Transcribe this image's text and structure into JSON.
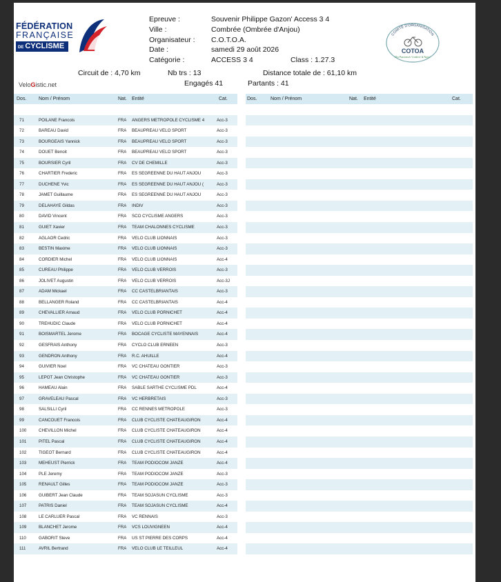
{
  "logo": {
    "line1": "FÉDÉRATION",
    "line2": "FRANÇAISE",
    "line3_prefix": "DE",
    "line3": "CYCLISME"
  },
  "event": [
    {
      "label": "Epreuve :",
      "value": "Souvenir Philippe Gazon' Access 3 4"
    },
    {
      "label": "Ville :",
      "value": "Combrée (Ombrée d'Anjou)"
    },
    {
      "label": "Organisateur :",
      "value": "C.O.T.O.A."
    },
    {
      "label": "Date :",
      "value": "samedi 29 août 2026"
    },
    {
      "label": "Catégorie :",
      "value": "ACCESS 3 4"
    }
  ],
  "class_text": "Class :   1.27.3",
  "stats": {
    "circuit": "Circuit de : 4,70  km",
    "nb_trs": "Nb trs :  13",
    "distance": "Distance totale de : 61,10  km",
    "engages": "Engagés  41",
    "partants": "Partants :  41"
  },
  "brand": {
    "pre": "Velo",
    "mid": "G",
    "post": "istic.net"
  },
  "org_logo": {
    "top": "COMITÉ D'ORGANISATION",
    "name": "COTOA",
    "bottom": "Des Passionnés 'Combrée & Anjou'"
  },
  "columns": {
    "dos": "Dos.",
    "name": "Nom / Prénom",
    "nat": "Nat.",
    "ent": "Entité",
    "cat": "Cat."
  },
  "riders": [
    {
      "dos": "71",
      "name": "POILANE  Francois",
      "nat": "FRA",
      "ent": "ANGERS METROPOLE CYCLISME 4",
      "cat": "Acc-3"
    },
    {
      "dos": "72",
      "name": "BAREAU  David",
      "nat": "FRA",
      "ent": "BEAUPREAU VELO SPORT",
      "cat": "Acc-3"
    },
    {
      "dos": "73",
      "name": "BOURGEAIS  Yannick",
      "nat": "FRA",
      "ent": "BEAUPREAU VELO SPORT",
      "cat": "Acc-3"
    },
    {
      "dos": "74",
      "name": "DOUET  Benoit",
      "nat": "FRA",
      "ent": "BEAUPREAU VELO SPORT",
      "cat": "Acc-3"
    },
    {
      "dos": "75",
      "name": "BOURSIER  Cyril",
      "nat": "FRA",
      "ent": "CV DE CHEMILLE",
      "cat": "Acc-3"
    },
    {
      "dos": "76",
      "name": "CHARTIER  Frederic",
      "nat": "FRA",
      "ent": "ES SEGREENNE DU HAUT ANJOU",
      "cat": "Acc-3"
    },
    {
      "dos": "77",
      "name": "DUCHENE  Yvic",
      "nat": "FRA",
      "ent": "ES SEGREENNE DU HAUT ANJOU (",
      "cat": "Acc-3"
    },
    {
      "dos": "78",
      "name": "JAMET  Guillaume",
      "nat": "FRA",
      "ent": "ES SEGREENNE DU HAUT ANJOU",
      "cat": "Acc-3"
    },
    {
      "dos": "79",
      "name": "DELAHAYE  Gildas",
      "nat": "FRA",
      "ent": "INDIV",
      "cat": "Acc-3"
    },
    {
      "dos": "80",
      "name": "DAVID  Vincent",
      "nat": "FRA",
      "ent": "SCO CYCLISME ANGERS",
      "cat": "Acc-3"
    },
    {
      "dos": "81",
      "name": "GUIET  Xavier",
      "nat": "FRA",
      "ent": "TEAM CHALONNES CYCLISME",
      "cat": "Acc-3"
    },
    {
      "dos": "82",
      "name": "AGLAOR  Cedric",
      "nat": "FRA",
      "ent": "VELO CLUB LIONNAIS",
      "cat": "Acc-3"
    },
    {
      "dos": "83",
      "name": "BESTIN  Maxime",
      "nat": "FRA",
      "ent": "VELO CLUB LIONNAIS",
      "cat": "Acc-3"
    },
    {
      "dos": "84",
      "name": "CORDIER  Michel",
      "nat": "FRA",
      "ent": "VELO CLUB LIONNAIS",
      "cat": "Acc-4"
    },
    {
      "dos": "85",
      "name": "CUREAU  Philippe",
      "nat": "FRA",
      "ent": "VELO CLUB VERROIS",
      "cat": "Acc-3"
    },
    {
      "dos": "86",
      "name": "JOLIVET  Augustin",
      "nat": "FRA",
      "ent": "VELO CLUB VERROIS",
      "cat": "Acc-3J"
    },
    {
      "dos": "87",
      "name": "ADAM  Mickael",
      "nat": "FRA",
      "ent": "CC CASTELBRIANTAIS",
      "cat": "Acc-3"
    },
    {
      "dos": "88",
      "name": "BELLANGER  Roland",
      "nat": "FRA",
      "ent": "CC CASTELBRIANTAIS",
      "cat": "Acc-4"
    },
    {
      "dos": "89",
      "name": "CHEVALLIER  Arnaud",
      "nat": "FRA",
      "ent": "VELO CLUB PORNICHET",
      "cat": "Acc-4"
    },
    {
      "dos": "90",
      "name": "TREHUDIC  Claude",
      "nat": "FRA",
      "ent": "VELO CLUB PORNICHET",
      "cat": "Acc-4"
    },
    {
      "dos": "91",
      "name": "BOISMARTEL  Jerome",
      "nat": "FRA",
      "ent": "BOCAGE CYCLISTE MAYENNAIS",
      "cat": "Acc-4"
    },
    {
      "dos": "92",
      "name": "GESFRAIS  Anthony",
      "nat": "FRA",
      "ent": "CYCLO CLUB ERNEEN",
      "cat": "Acc-3"
    },
    {
      "dos": "93",
      "name": "GENDRON  Anthony",
      "nat": "FRA",
      "ent": "R.C. AHUILLE",
      "cat": "Acc-4"
    },
    {
      "dos": "94",
      "name": "GUIVIER  Noel",
      "nat": "FRA",
      "ent": "VC CHATEAU GONTIER",
      "cat": "Acc-3"
    },
    {
      "dos": "95",
      "name": "LEPOT  Jean Christophe",
      "nat": "FRA",
      "ent": "VC CHATEAU GONTIER",
      "cat": "Acc-3"
    },
    {
      "dos": "96",
      "name": "HAMEAU  Alain",
      "nat": "FRA",
      "ent": "SABLE SARTHE CYCLISME PDL",
      "cat": "Acc-4"
    },
    {
      "dos": "97",
      "name": "GRAVELEAU  Pascal",
      "nat": "FRA",
      "ent": "VC HERBRETAIS",
      "cat": "Acc-3"
    },
    {
      "dos": "98",
      "name": "SALSILLI  Cyril",
      "nat": "FRA",
      "ent": "CC RENNES METROPOLE",
      "cat": "Acc-3"
    },
    {
      "dos": "99",
      "name": "CANCOUET  Francois",
      "nat": "FRA",
      "ent": "CLUB CYCLISTE CHATEAUGIRON",
      "cat": "Acc-4"
    },
    {
      "dos": "100",
      "name": "CHEVILLON  Michel",
      "nat": "FRA",
      "ent": "CLUB CYCLISTE CHATEAUGIRON",
      "cat": "Acc-4"
    },
    {
      "dos": "101",
      "name": "PITEL  Pascal",
      "nat": "FRA",
      "ent": "CLUB CYCLISTE CHATEAUGIRON",
      "cat": "Acc-4"
    },
    {
      "dos": "102",
      "name": "TIGEOT  Bernard",
      "nat": "FRA",
      "ent": "CLUB CYCLISTE CHATEAUGIRON",
      "cat": "Acc-4"
    },
    {
      "dos": "103",
      "name": "MEHEUST  Pierrick",
      "nat": "FRA",
      "ent": "TEAM PODIOCOM JANZE",
      "cat": "Acc-4"
    },
    {
      "dos": "104",
      "name": "PLE  Jeremy",
      "nat": "FRA",
      "ent": "TEAM PODIOCOM JANZE",
      "cat": "Acc-3"
    },
    {
      "dos": "105",
      "name": "RENAULT  Gilles",
      "nat": "FRA",
      "ent": "TEAM PODIOCOM JANZE",
      "cat": "Acc-3"
    },
    {
      "dos": "106",
      "name": "GUIBERT  Jean Claude",
      "nat": "FRA",
      "ent": "TEAM SOJASUN CYCLISME",
      "cat": "Acc-3"
    },
    {
      "dos": "107",
      "name": "PATRIS  Daniel",
      "nat": "FRA",
      "ent": "TEAM SOJASUN CYCLISME",
      "cat": "Acc-4"
    },
    {
      "dos": "108",
      "name": "LE CARLUER  Pascal",
      "nat": "FRA",
      "ent": "VC RENNAIS",
      "cat": "Acc-3"
    },
    {
      "dos": "109",
      "name": "BLANCHET  Jerome",
      "nat": "FRA",
      "ent": "VCS LOUVIGNEEN",
      "cat": "Acc-4"
    },
    {
      "dos": "110",
      "name": "GABORIT  Steve",
      "nat": "FRA",
      "ent": "US ST PIERRE DES CORPS",
      "cat": "Acc-4"
    },
    {
      "dos": "111",
      "name": "AVRIL  Bertrand",
      "nat": "FRA",
      "ent": "VELO CLUB LE TEILLEUL",
      "cat": "Acc-4"
    }
  ]
}
